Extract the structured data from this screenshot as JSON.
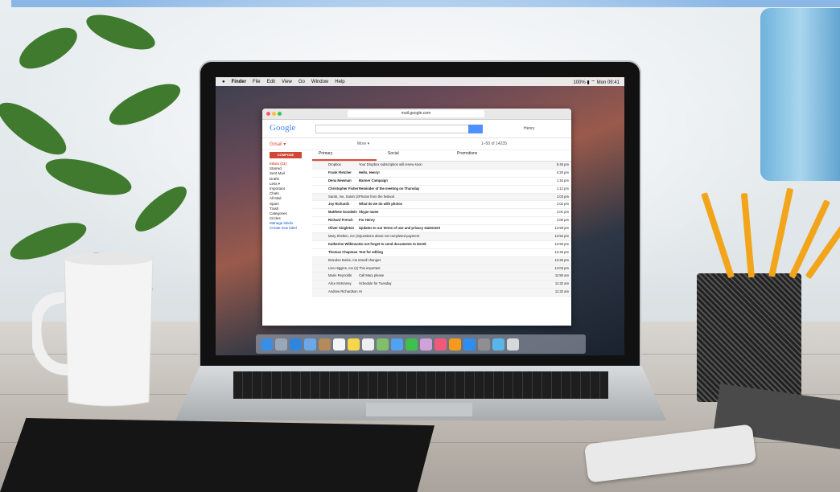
{
  "menubar": {
    "apple": "",
    "items": [
      "Finder",
      "File",
      "Edit",
      "View",
      "Go",
      "Window",
      "Help"
    ],
    "right": "100% ▮  ⌔  Mon 09:41"
  },
  "browser": {
    "url": "mail.google.com"
  },
  "gmail": {
    "logo": "Google",
    "user": "Henry",
    "label": "Gmail ▾",
    "more": "More ▾",
    "pager": "1–50 of 14235",
    "compose": "COMPOSE",
    "folders": [
      "Inbox (11)",
      "Starred",
      "Sent Mail",
      "Drafts",
      "Less ▾",
      "Important",
      "Chats",
      "All Mail",
      "Spam",
      "Trash",
      "Categories",
      "Circles",
      "Manage labels",
      "Create new label"
    ],
    "tabs": {
      "primary": "Primary",
      "social": "Social",
      "promotions": "Promotions"
    },
    "rows": [
      {
        "sender": "Dropbox",
        "subject": "Your Dropbox subscription will renew soon",
        "time": "5:45 pm",
        "unread": false
      },
      {
        "sender": "Frank Fletcher",
        "subject": "Hello, Henry!",
        "time": "4:20 pm",
        "unread": true
      },
      {
        "sender": "Dena Newman",
        "subject": "Banner Campaign",
        "time": "1:16 pm",
        "unread": true
      },
      {
        "sender": "Christopher Fisher",
        "subject": "Reminder of the meeting on Thursday",
        "time": "1:12 pm",
        "unread": true
      },
      {
        "sender": "Sarah, me, Sarah (3)",
        "subject": "Photos from the festival",
        "time": "1:03 pm",
        "unread": false
      },
      {
        "sender": "Joy Richards",
        "subject": "What do we do with photos",
        "time": "1:02 pm",
        "unread": true
      },
      {
        "sender": "Matthew Goodwin",
        "subject": "Skype name",
        "time": "1:01 pm",
        "unread": true
      },
      {
        "sender": "Richard French",
        "subject": "For Henry",
        "time": "1:00 pm",
        "unread": true
      },
      {
        "sender": "Oliver Singleton",
        "subject": "Updates to our terms of use and privacy statement",
        "time": "12:59 pm",
        "unread": true
      },
      {
        "sender": "Mary Shelton, me (3)",
        "subject": "Questions about not completed payment",
        "time": "12:52 pm",
        "unread": false
      },
      {
        "sender": "Katherine Wilkinson",
        "subject": "Do not forget to send documents to Derek",
        "time": "12:50 pm",
        "unread": true
      },
      {
        "sender": "Thomas Chapman",
        "subject": "Text for editing",
        "time": "12:45 pm",
        "unread": true
      },
      {
        "sender": "Brandon Burke, me (2)",
        "subject": "Small changes",
        "time": "12:25 pm",
        "unread": false
      },
      {
        "sender": "Lisa Higgins, me (2)",
        "subject": "This important",
        "time": "12:03 pm",
        "unread": false
      },
      {
        "sender": "Marie Reynolds",
        "subject": "Call Mary please",
        "time": "11:50 am",
        "unread": false
      },
      {
        "sender": "Alice McKinney",
        "subject": "Schedule for Tuesday",
        "time": "11:32 am",
        "unread": false
      },
      {
        "sender": "Andrew Richardson",
        "subject": "Hi",
        "time": "11:32 am",
        "unread": false
      }
    ]
  },
  "colors": {
    "topbar": "#8ab7e6",
    "gmail_red": "#dd4b39",
    "google_blue": "#4285f4"
  }
}
